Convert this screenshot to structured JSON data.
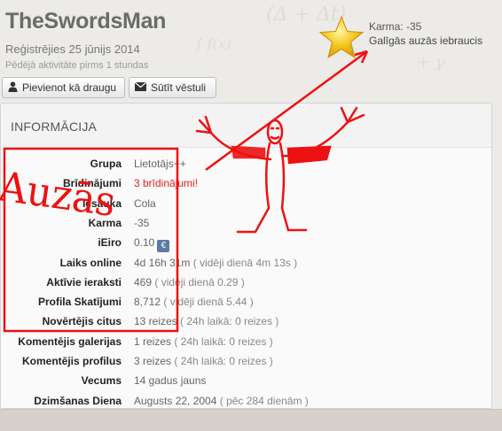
{
  "profile": {
    "username": "TheSwordsMan",
    "registered": "Reģistrējies 25 jūnijs 2014",
    "last_activity": "Pēdējā aktivitāte pirms 1 stundas"
  },
  "actions": {
    "add_friend": "Pievienot kā draugu",
    "send_message": "Sūtīt vēstuli"
  },
  "karma_box": {
    "karma": "Karma: -35",
    "status": "Galīgās auzās iebraucis"
  },
  "panel": {
    "title": "INFORMĀCIJA",
    "rows": [
      {
        "label": "Grupa",
        "value": "Lietotājs++"
      },
      {
        "label": "Brīdinājumi",
        "value": "3 brīdinājumi!"
      },
      {
        "label": "Iesauka",
        "value": "Cola"
      },
      {
        "label": "Karma",
        "value": "-35"
      },
      {
        "label": "iEiro",
        "value": "0.10",
        "badge": "€"
      },
      {
        "label": "Laiks online",
        "value": "4d 16h 31m",
        "extra": "( vidēji dienā 4m 13s )"
      },
      {
        "label": "Aktīvie ieraksti",
        "value": "469",
        "extra": "( vidēji dienā 0.29 )"
      },
      {
        "label": "Profila Skatījumi",
        "value": "8,712",
        "extra": "( vidēji dienā 5.44 )"
      },
      {
        "label": "Novērtējis citus",
        "value": "13 reizes",
        "extra": "( 24h laikā: 0 reizes )"
      },
      {
        "label": "Komentējis galerijas",
        "value": "1 reizes",
        "extra": "( 24h laikā: 0 reizes )"
      },
      {
        "label": "Komentējis profilus",
        "value": "3 reizes",
        "extra": "( 24h laikā: 0 reizes )"
      },
      {
        "label": "Vecums",
        "value": "14 gadus jauns"
      },
      {
        "label": "Dzimšanas Diena",
        "value": "Augusts 22, 2004",
        "extra": "( pēc 284 dienām )"
      }
    ]
  },
  "annotation": {
    "handwritten": "Auzās",
    "colors": {
      "ink": "#ee1111",
      "star": "#f2c21b",
      "accent_red": "#dd2222"
    }
  }
}
